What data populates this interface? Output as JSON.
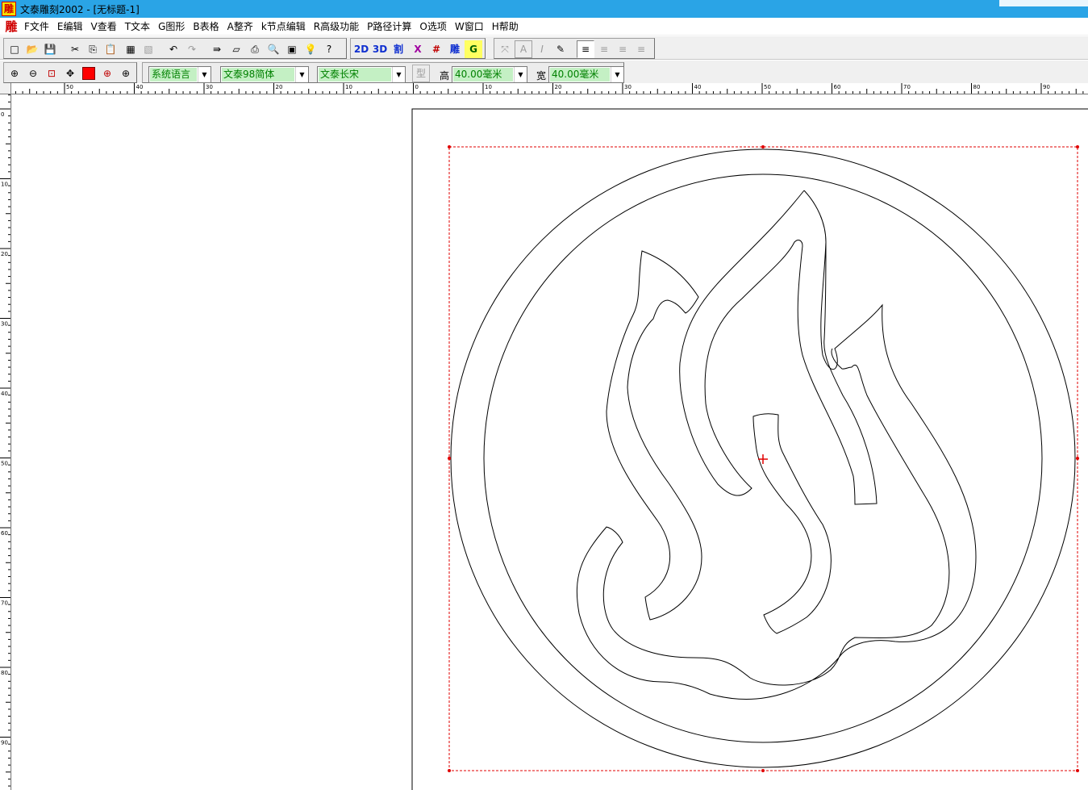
{
  "window": {
    "app_icon_glyph": "雕",
    "title": "文泰雕刻2002 - [无标题-1]"
  },
  "menu": {
    "doc_icon_glyph": "雕",
    "items": [
      "F文件",
      "E编辑",
      "V查看",
      "T文本",
      "G图形",
      "B表格",
      "A整齐",
      "k节点编辑",
      "R高级功能",
      "P路径计算",
      "O选项",
      "W窗口",
      "H帮助"
    ]
  },
  "toolbar_main": {
    "new_icon": "□",
    "open_icon": "📂",
    "save_icon": "💾",
    "cut_icon": "✂",
    "copy_icon": "⎘",
    "paste_icon": "📋",
    "paste2_icon": "▦",
    "clone_icon": "▧",
    "undo_icon": "↶",
    "redo_icon": "↷",
    "import_icon": "⇛",
    "page_icon": "▱",
    "print_icon": "⎙",
    "preview_icon": "🔍",
    "frame_icon": "▣",
    "bulb_icon": "💡",
    "help_icon": "?",
    "btn_2d": "2D",
    "btn_3d": "3D",
    "btn_cut": "割",
    "btn_x": "X",
    "btn_hash": "#",
    "btn_carve": "雕",
    "btn_gcode": "G",
    "node_icon": "⤧",
    "text_a_icon": "A",
    "italic_icon": "I",
    "edit_icon": "✎",
    "align_left_icon": "≡",
    "align_center_icon": "≡",
    "align_right_icon": "≡",
    "align_justify_icon": "≡"
  },
  "toolbar_text": {
    "zoom_in_icon": "⊕",
    "zoom_out_icon": "⊖",
    "zoom_fit_icon": "⊡",
    "pan_icon": "✥",
    "zoom_sel_icon": "⊕",
    "zoom_all_icon": "⊕",
    "language_value": "系统语言",
    "font_value": "文泰98简体",
    "font2_value": "文泰长宋",
    "style_icon": "型",
    "height_label": "高",
    "height_value": "40.00毫米",
    "width_label": "宽",
    "width_value": "40.00毫米",
    "arrow_glyph": "▼"
  },
  "ruler": {
    "top_labels": [
      "50",
      "40",
      "30",
      "20",
      "10",
      "0",
      "10",
      "20",
      "30",
      "40",
      "50",
      "60",
      "70",
      "80",
      "90"
    ],
    "left_labels": [
      "0",
      "10",
      "20",
      "30",
      "40",
      "50",
      "60",
      "70",
      "80",
      "90"
    ]
  },
  "colors": {
    "titlebar": "#2aa4e6",
    "selection": "#e00000",
    "input_bg": "#c4f0c4",
    "input_text": "#008000"
  }
}
